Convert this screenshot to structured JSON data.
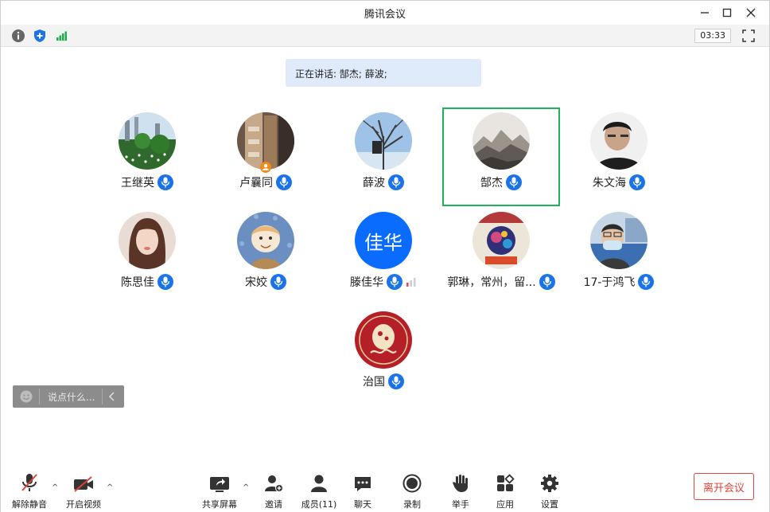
{
  "window": {
    "title": "腾讯会议",
    "timer": "03:33"
  },
  "speaking": {
    "text": "正在讲话: 郜杰; 薛波;"
  },
  "participants": [
    {
      "name": "王继英",
      "avatar": "landscape-photo"
    },
    {
      "name": "卢曩同",
      "avatar": "interior-photo",
      "host": true
    },
    {
      "name": "薛波",
      "avatar": "tree-photo"
    },
    {
      "name": "郜杰",
      "avatar": "mountain-photo",
      "active": true
    },
    {
      "name": "朱文海",
      "avatar": "person-photo"
    },
    {
      "name": "陈思佳",
      "avatar": "portrait-photo"
    },
    {
      "name": "宋姣",
      "avatar": "cartoon-photo"
    },
    {
      "name": "滕佳华",
      "avatar_text": "佳华",
      "avatar_color": "#0a6cff"
    },
    {
      "name": "郭琳，常州，留...",
      "avatar": "poster-photo"
    },
    {
      "name": "17-于鸿飞",
      "avatar": "masked-person-photo"
    },
    {
      "name": "治国",
      "avatar": "senior-logo"
    }
  ],
  "chat": {
    "placeholder": "说点什么..."
  },
  "controls": {
    "unmute": "解除静音",
    "video": "开启视频",
    "share": "共享屏幕",
    "invite": "邀请",
    "members": "成员(11)",
    "chat": "聊天",
    "record": "录制",
    "raise_hand": "举手",
    "apps": "应用",
    "settings": "设置",
    "leave": "离开会议"
  },
  "colors": {
    "accent": "#1a73e8",
    "active_border": "#1fb25a",
    "leave": "#e0433a"
  }
}
